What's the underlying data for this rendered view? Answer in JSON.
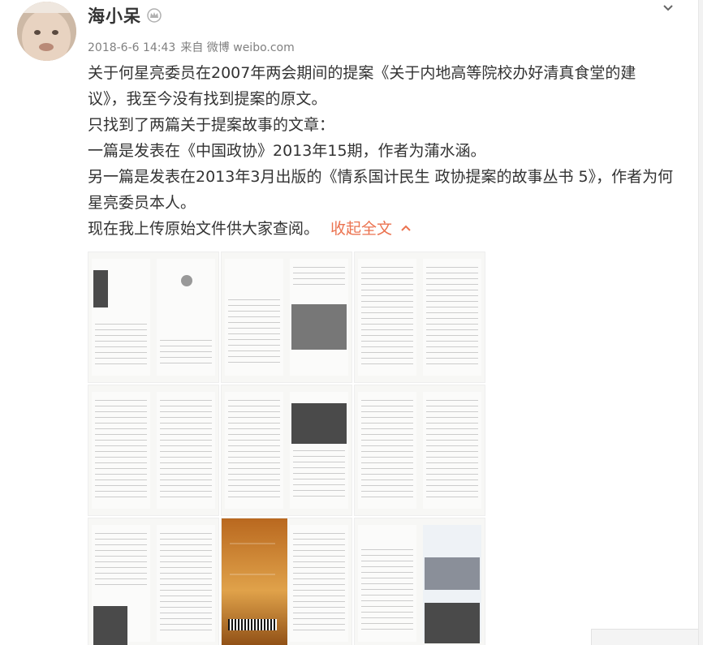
{
  "post": {
    "username": "海小呆",
    "badge_icon": "crown-icon",
    "date": "2018-6-6 14:43",
    "source": "来自 微博 weibo.com",
    "paragraphs": [
      "关于何星亮委员在2007年两会期间的提案《关于内地高等院校办好清真食堂的建议》，我至今没有找到提案的原文。",
      "只找到了两篇关于提案故事的文章：",
      "一篇是发表在《中国政协》2013年15期，作者为蒲水涵。",
      "另一篇是发表在2013年3月出版的《情系国计民生 政协提案的故事丛书 5》，作者为何星亮委员本人。",
      "现在我上传原始文件供大家查阅。"
    ],
    "collapse_label": "收起全文",
    "link_color": "#eb7350"
  },
  "images": [
    {
      "name": "image-1"
    },
    {
      "name": "image-2"
    },
    {
      "name": "image-3"
    },
    {
      "name": "image-4"
    },
    {
      "name": "image-5"
    },
    {
      "name": "image-6"
    },
    {
      "name": "image-7"
    },
    {
      "name": "image-8"
    },
    {
      "name": "image-9"
    }
  ]
}
